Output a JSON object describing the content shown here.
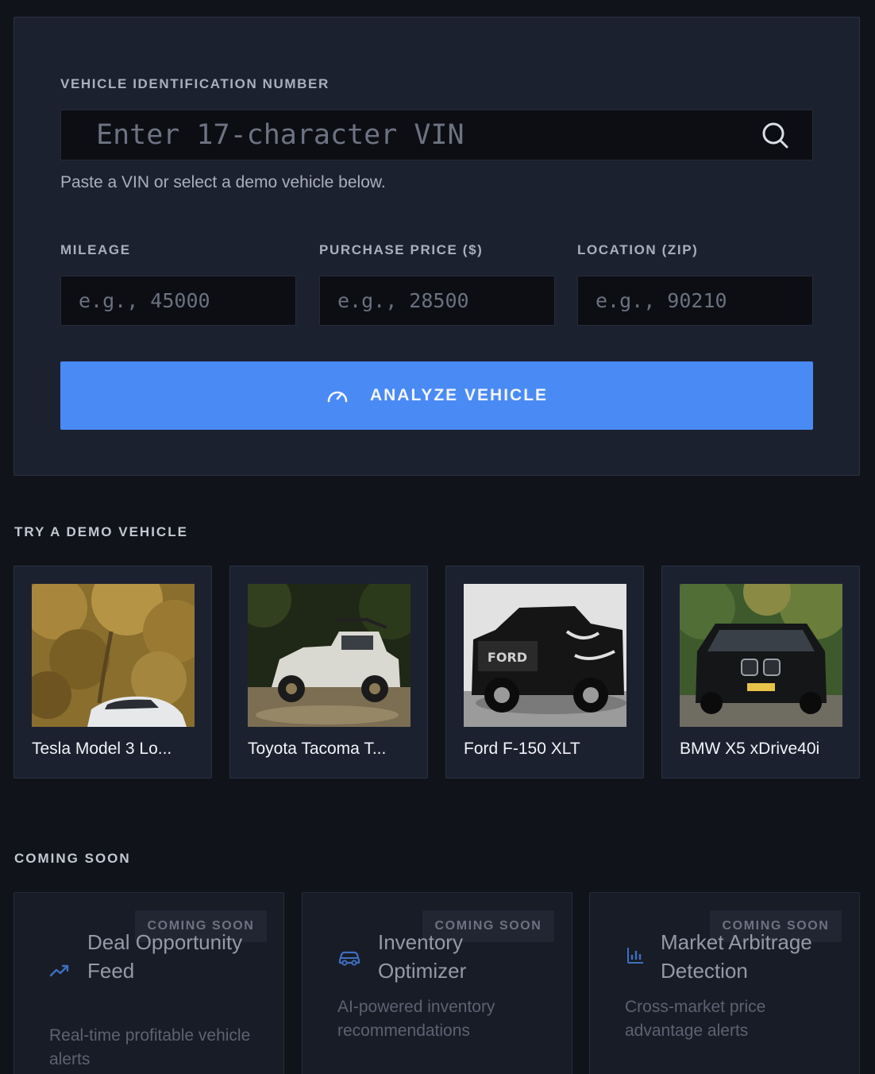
{
  "form": {
    "vin_label": "VEHICLE IDENTIFICATION NUMBER",
    "vin_placeholder": "Enter 17-character VIN",
    "vin_helper": "Paste a VIN or select a demo vehicle below.",
    "mileage_label": "MILEAGE",
    "mileage_placeholder": "e.g., 45000",
    "price_label": "PURCHASE PRICE ($)",
    "price_placeholder": "e.g., 28500",
    "location_label": "LOCATION (ZIP)",
    "location_placeholder": "e.g., 90210",
    "analyze_label": "ANALYZE VEHICLE",
    "analyze_icon": "speedometer-icon",
    "search_icon": "search-icon",
    "accent_color": "#4a8af4"
  },
  "demo": {
    "title": "TRY A DEMO VEHICLE",
    "vehicles": [
      {
        "name": "Tesla Model 3 Lo...",
        "image_icon": "tesla-photo"
      },
      {
        "name": "Toyota Tacoma T...",
        "image_icon": "tacoma-photo"
      },
      {
        "name": "Ford F-150 XLT",
        "image_icon": "f150-photo"
      },
      {
        "name": "BMW X5 xDrive40i",
        "image_icon": "bmw-x5-photo"
      }
    ]
  },
  "coming_soon": {
    "title": "COMING SOON",
    "features": [
      {
        "badge": "COMING SOON",
        "title": "Deal Opportunity Feed",
        "description": "Real-time profitable vehicle alerts",
        "icon": "trending-up-icon"
      },
      {
        "badge": "COMING SOON",
        "title": "Inventory Optimizer",
        "description": "AI-powered inventory recommendations",
        "icon": "car-icon"
      },
      {
        "badge": "COMING SOON",
        "title": "Market Arbitrage Detection",
        "description": "Cross-market price advantage alerts",
        "icon": "bar-chart-icon"
      }
    ]
  }
}
